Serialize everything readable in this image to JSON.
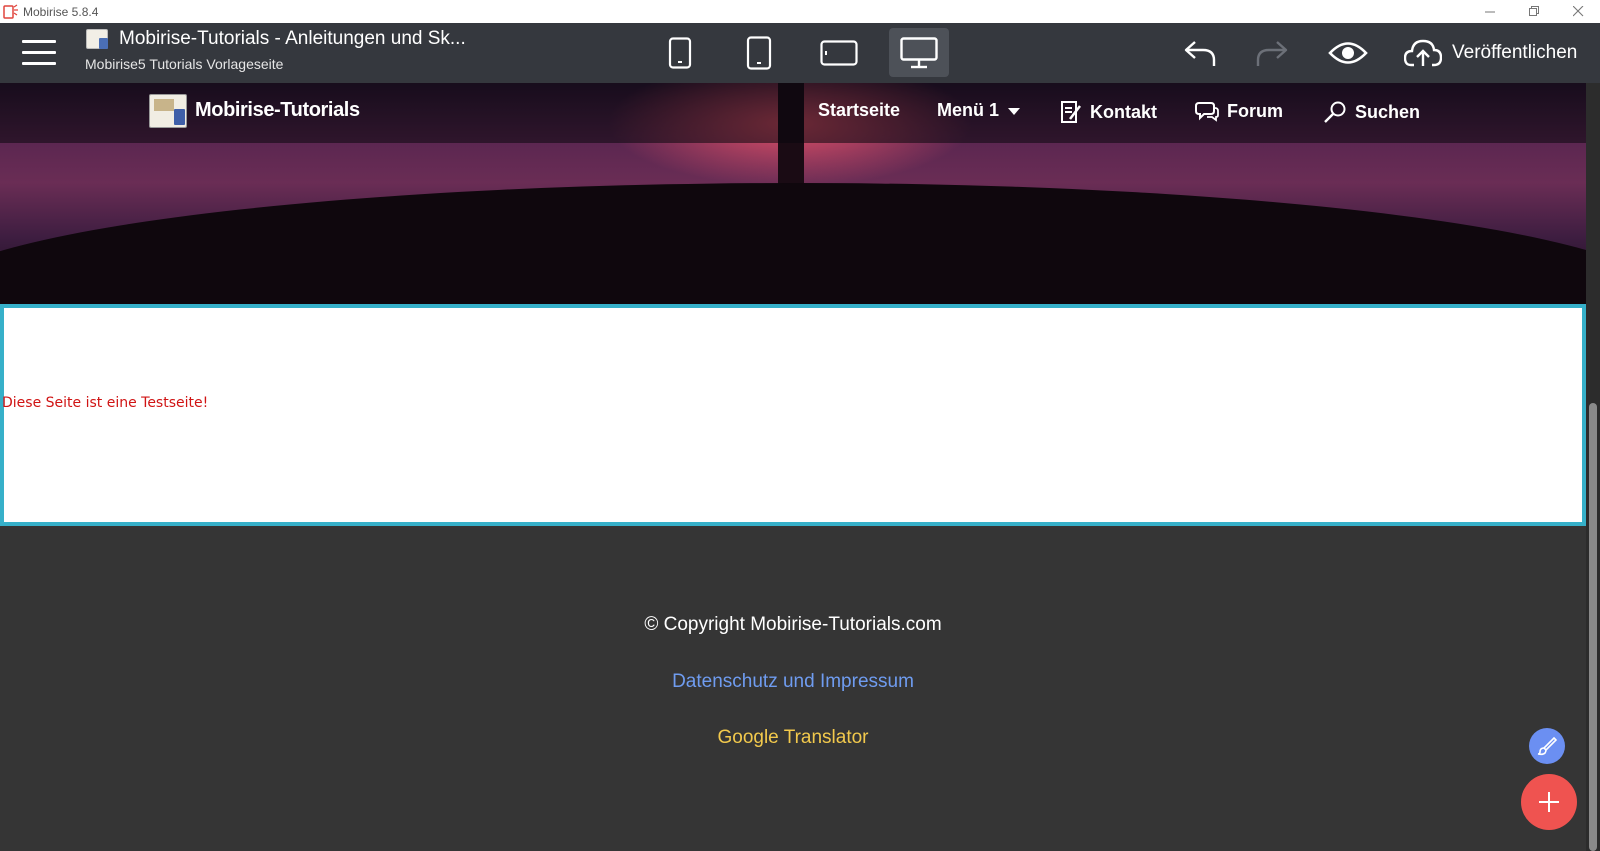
{
  "window": {
    "title": "Mobirise 5.8.4",
    "minimize_icon": "minimize-icon",
    "maximize_icon": "restore-icon",
    "close_icon": "close-icon"
  },
  "toolbar": {
    "project_title": "Mobirise-Tutorials - Anleitungen und Sk...",
    "project_subtitle": "Mobirise5 Tutorials Vorlageseite",
    "devices": [
      "phone-small",
      "phone",
      "tablet",
      "desktop"
    ],
    "active_device": "desktop",
    "publish_label": "Veröffentlichen",
    "icons": [
      "menu-icon",
      "undo-icon",
      "redo-icon",
      "preview-eye-icon",
      "cloud-upload-icon"
    ]
  },
  "site": {
    "brand": "Mobirise-Tutorials",
    "nav": [
      {
        "label": "Startseite",
        "icon": ""
      },
      {
        "label": "Menü 1",
        "icon": "caret-down-icon"
      },
      {
        "label": "Kontakt",
        "icon": "edit-form-icon"
      },
      {
        "label": "Forum",
        "icon": "chat-icon"
      },
      {
        "label": "Suchen",
        "icon": "search-icon"
      }
    ]
  },
  "content": {
    "test_text": "Diese Seite ist eine Testseite!"
  },
  "footer": {
    "copyright": "© Copyright Mobirise-Tutorials.com",
    "privacy_link": "Datenschutz und Impressum",
    "translator_link": "Google Translator"
  },
  "colors": {
    "selection_border": "#36b0c9",
    "test_text": "#d01414",
    "privacy_link": "#6f9cf0",
    "translator_link": "#f2c94c",
    "fab_edit": "#6b8ff2",
    "fab_add": "#ef5350"
  }
}
